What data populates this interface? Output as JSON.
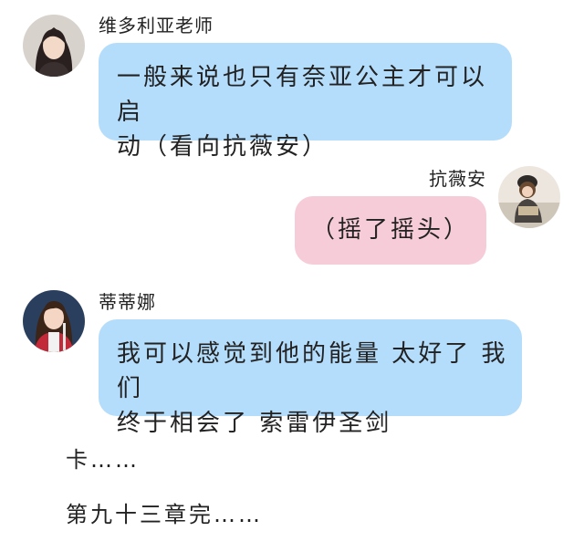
{
  "messages": [
    {
      "sender": "维多利亚老师",
      "side": "left",
      "bubble_color": "#b4dcfb",
      "lines": [
        "一般来说也只有奈亚公主才可以启",
        "动（看向抗薇安）"
      ]
    },
    {
      "sender": "抗薇安",
      "side": "right",
      "bubble_color": "#f6ccd8",
      "lines": [
        "（摇了摇头）"
      ]
    },
    {
      "sender": "蒂蒂娜",
      "side": "left",
      "bubble_color": "#b4dcfb",
      "lines": [
        "我可以感觉到他的能量 太好了 我们",
        "终于相会了 索雷伊圣剑"
      ]
    }
  ],
  "narration": [
    "卡……",
    "第九十三章完……"
  ]
}
